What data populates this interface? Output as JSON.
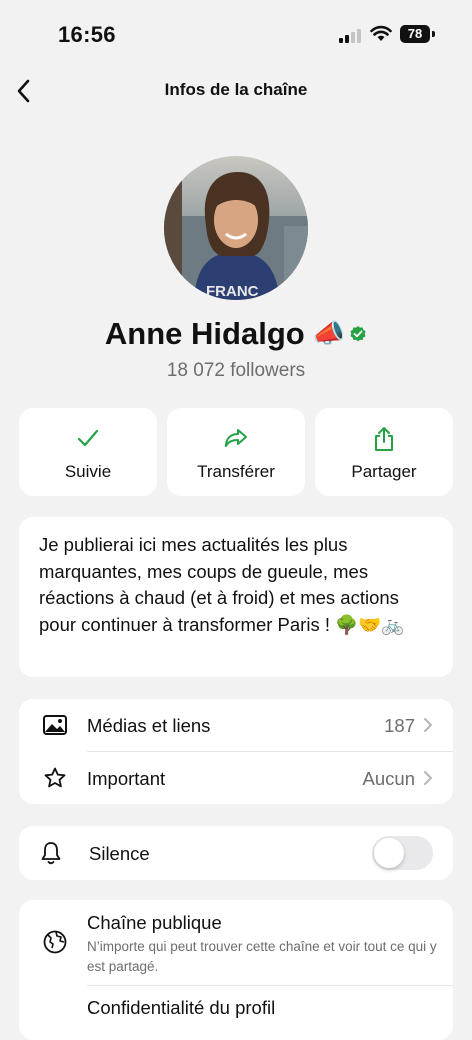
{
  "status_bar": {
    "time": "16:56",
    "battery": "78"
  },
  "nav": {
    "title": "Infos de la chaîne"
  },
  "channel": {
    "name": "Anne Hidalgo",
    "name_emoji": "📣",
    "followers": "18 072 followers",
    "verified_color": "#25a244"
  },
  "actions": [
    {
      "label": "Suivie",
      "icon": "checkmark-icon"
    },
    {
      "label": "Transférer",
      "icon": "forward-arrow-icon"
    },
    {
      "label": "Partager",
      "icon": "share-icon"
    }
  ],
  "description": "Je publierai ici mes actualités les plus marquantes, mes coups de gueule, mes réactions à chaud (et à froid) et mes actions pour continuer à transformer Paris ! 🌳🤝🚲",
  "media_section": {
    "media": {
      "label": "Médias et liens",
      "value": "187",
      "icon": "image-icon"
    },
    "important": {
      "label": "Important",
      "value": "Aucun",
      "icon": "star-icon"
    }
  },
  "silence": {
    "label": "Silence",
    "icon": "bell-icon",
    "enabled": false
  },
  "privacy": {
    "public": {
      "label": "Chaîne publique",
      "description": "N’importe qui peut trouver cette chaîne et voir tout ce qui y est partagé.",
      "icon": "globe-icon"
    },
    "profile": {
      "label": "Confidentialité du profil"
    }
  },
  "colors": {
    "accent": "#25a244",
    "background": "#f2f2f2",
    "card": "#ffffff",
    "secondary_text": "#6d6d6d"
  }
}
